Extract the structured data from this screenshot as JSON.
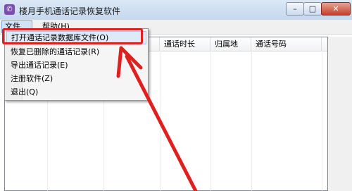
{
  "window": {
    "title": "楼月手机通话记录恢复软件",
    "app_icon": "phone-app-icon",
    "controls": {
      "minimize": "–",
      "maximize": "□",
      "close": "✕"
    }
  },
  "menubar": {
    "file": "文件(F)",
    "help": "帮助(H)"
  },
  "file_menu": {
    "items": [
      {
        "label": "打开通话记录数据库文件(O)",
        "highlighted": true
      },
      {
        "label": "恢复已删除的通话记录(R)"
      },
      {
        "label": "导出通话记录(E)"
      },
      {
        "label": "注册软件(Z)"
      },
      {
        "label": "退出(Q)"
      }
    ]
  },
  "table": {
    "columns": [
      "",
      "",
      "",
      "通话时长",
      "归属地",
      "通话号码"
    ]
  },
  "annotation": {
    "color": "#e01f1f",
    "shape": "arrow pointing to highlighted menu item"
  }
}
